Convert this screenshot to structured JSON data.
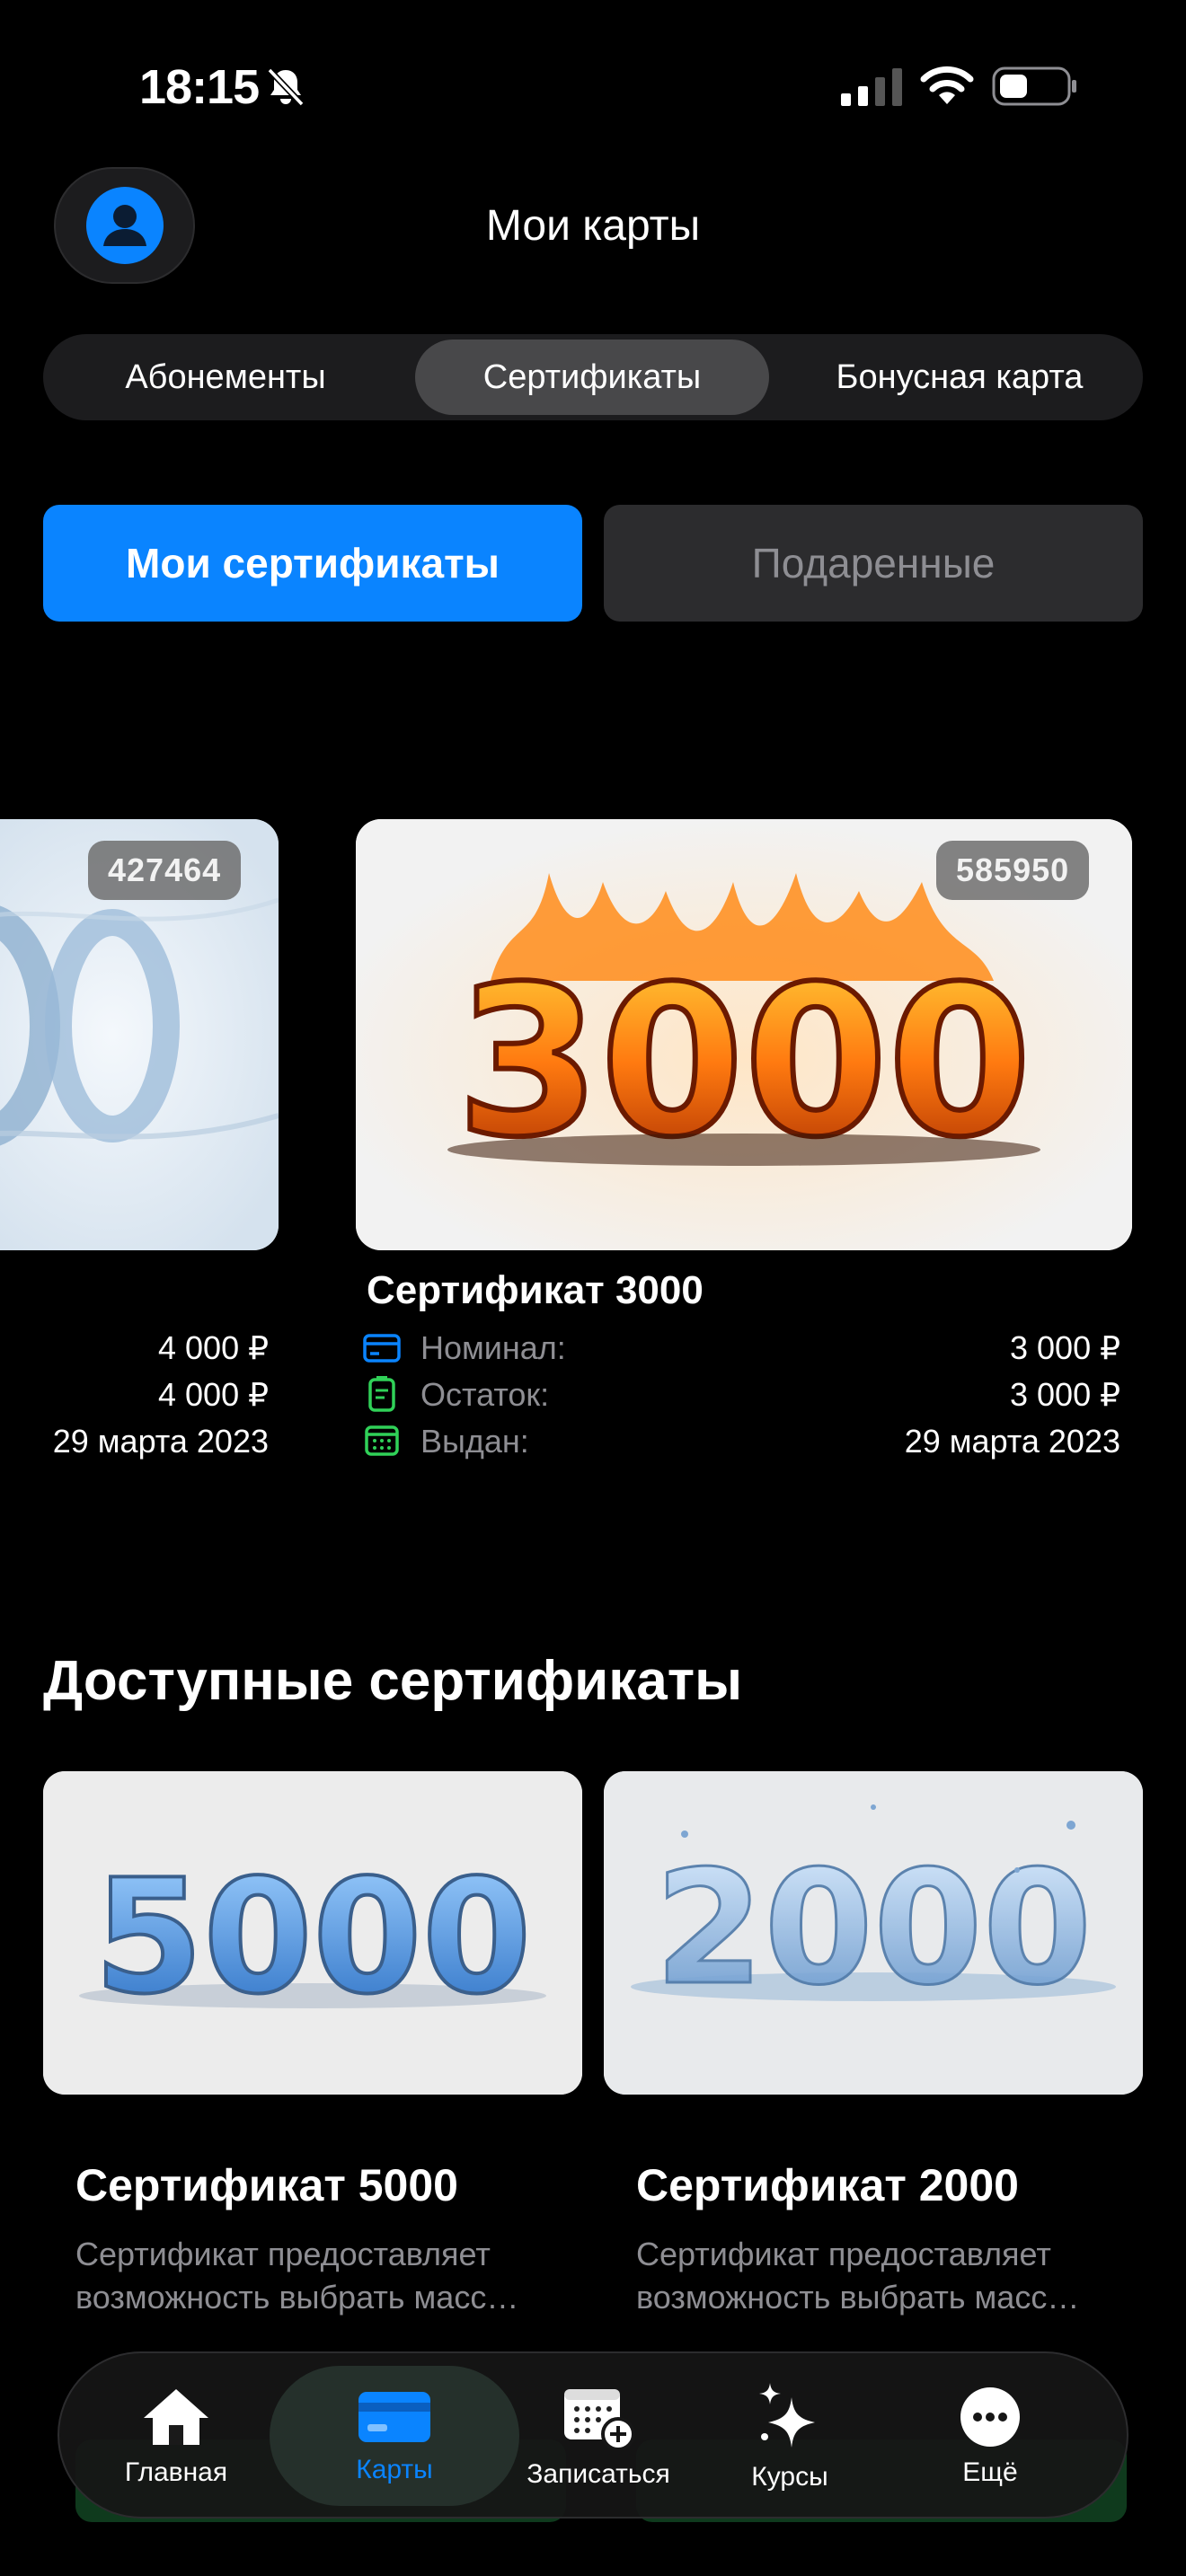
{
  "status_bar": {
    "time": "18:15"
  },
  "header": {
    "title": "Мои карты"
  },
  "segments": [
    "Абонементы",
    "Сертификаты",
    "Бонусная карта"
  ],
  "subtabs": {
    "mine": "Мои сертификаты",
    "gifted": "Подаренные"
  },
  "my_certificates": [
    {
      "code": "427464",
      "image": "ice-4000",
      "nominal": "4 000 ₽",
      "balance": "4 000 ₽",
      "issued": "29 марта 2023"
    },
    {
      "code": "585950",
      "image": "fire-3000",
      "image_text": "3000",
      "title": "Сертификат 3000",
      "nominal_label": "Номинал:",
      "nominal": "3 000 ₽",
      "balance_label": "Остаток:",
      "balance": "3 000 ₽",
      "issued_label": "Выдан:",
      "issued": "29 марта 2023"
    }
  ],
  "available": {
    "title": "Доступные сертификаты",
    "items": [
      {
        "image_text": "5000",
        "title": "Сертификат 5000",
        "desc_line1": "Сертификат предоставляет",
        "desc_line2": "возможность выбрать масс…"
      },
      {
        "image_text": "2000",
        "title": "Сертификат 2000",
        "desc_line1": "Сертификат предоставляет",
        "desc_line2": "возможность выбрать масс…"
      }
    ]
  },
  "tabbar": {
    "active": "Карты",
    "items": [
      {
        "label": "Главная",
        "icon": "house-icon"
      },
      {
        "label": "Карты",
        "icon": "card-icon"
      },
      {
        "label": "Записаться",
        "icon": "calendar-add-icon"
      },
      {
        "label": "Курсы",
        "icon": "sparkles-icon"
      },
      {
        "label": "Ещё",
        "icon": "more-icon"
      }
    ]
  },
  "colors": {
    "accent": "#0a84ff",
    "green": "#30d158",
    "background": "#000000"
  }
}
